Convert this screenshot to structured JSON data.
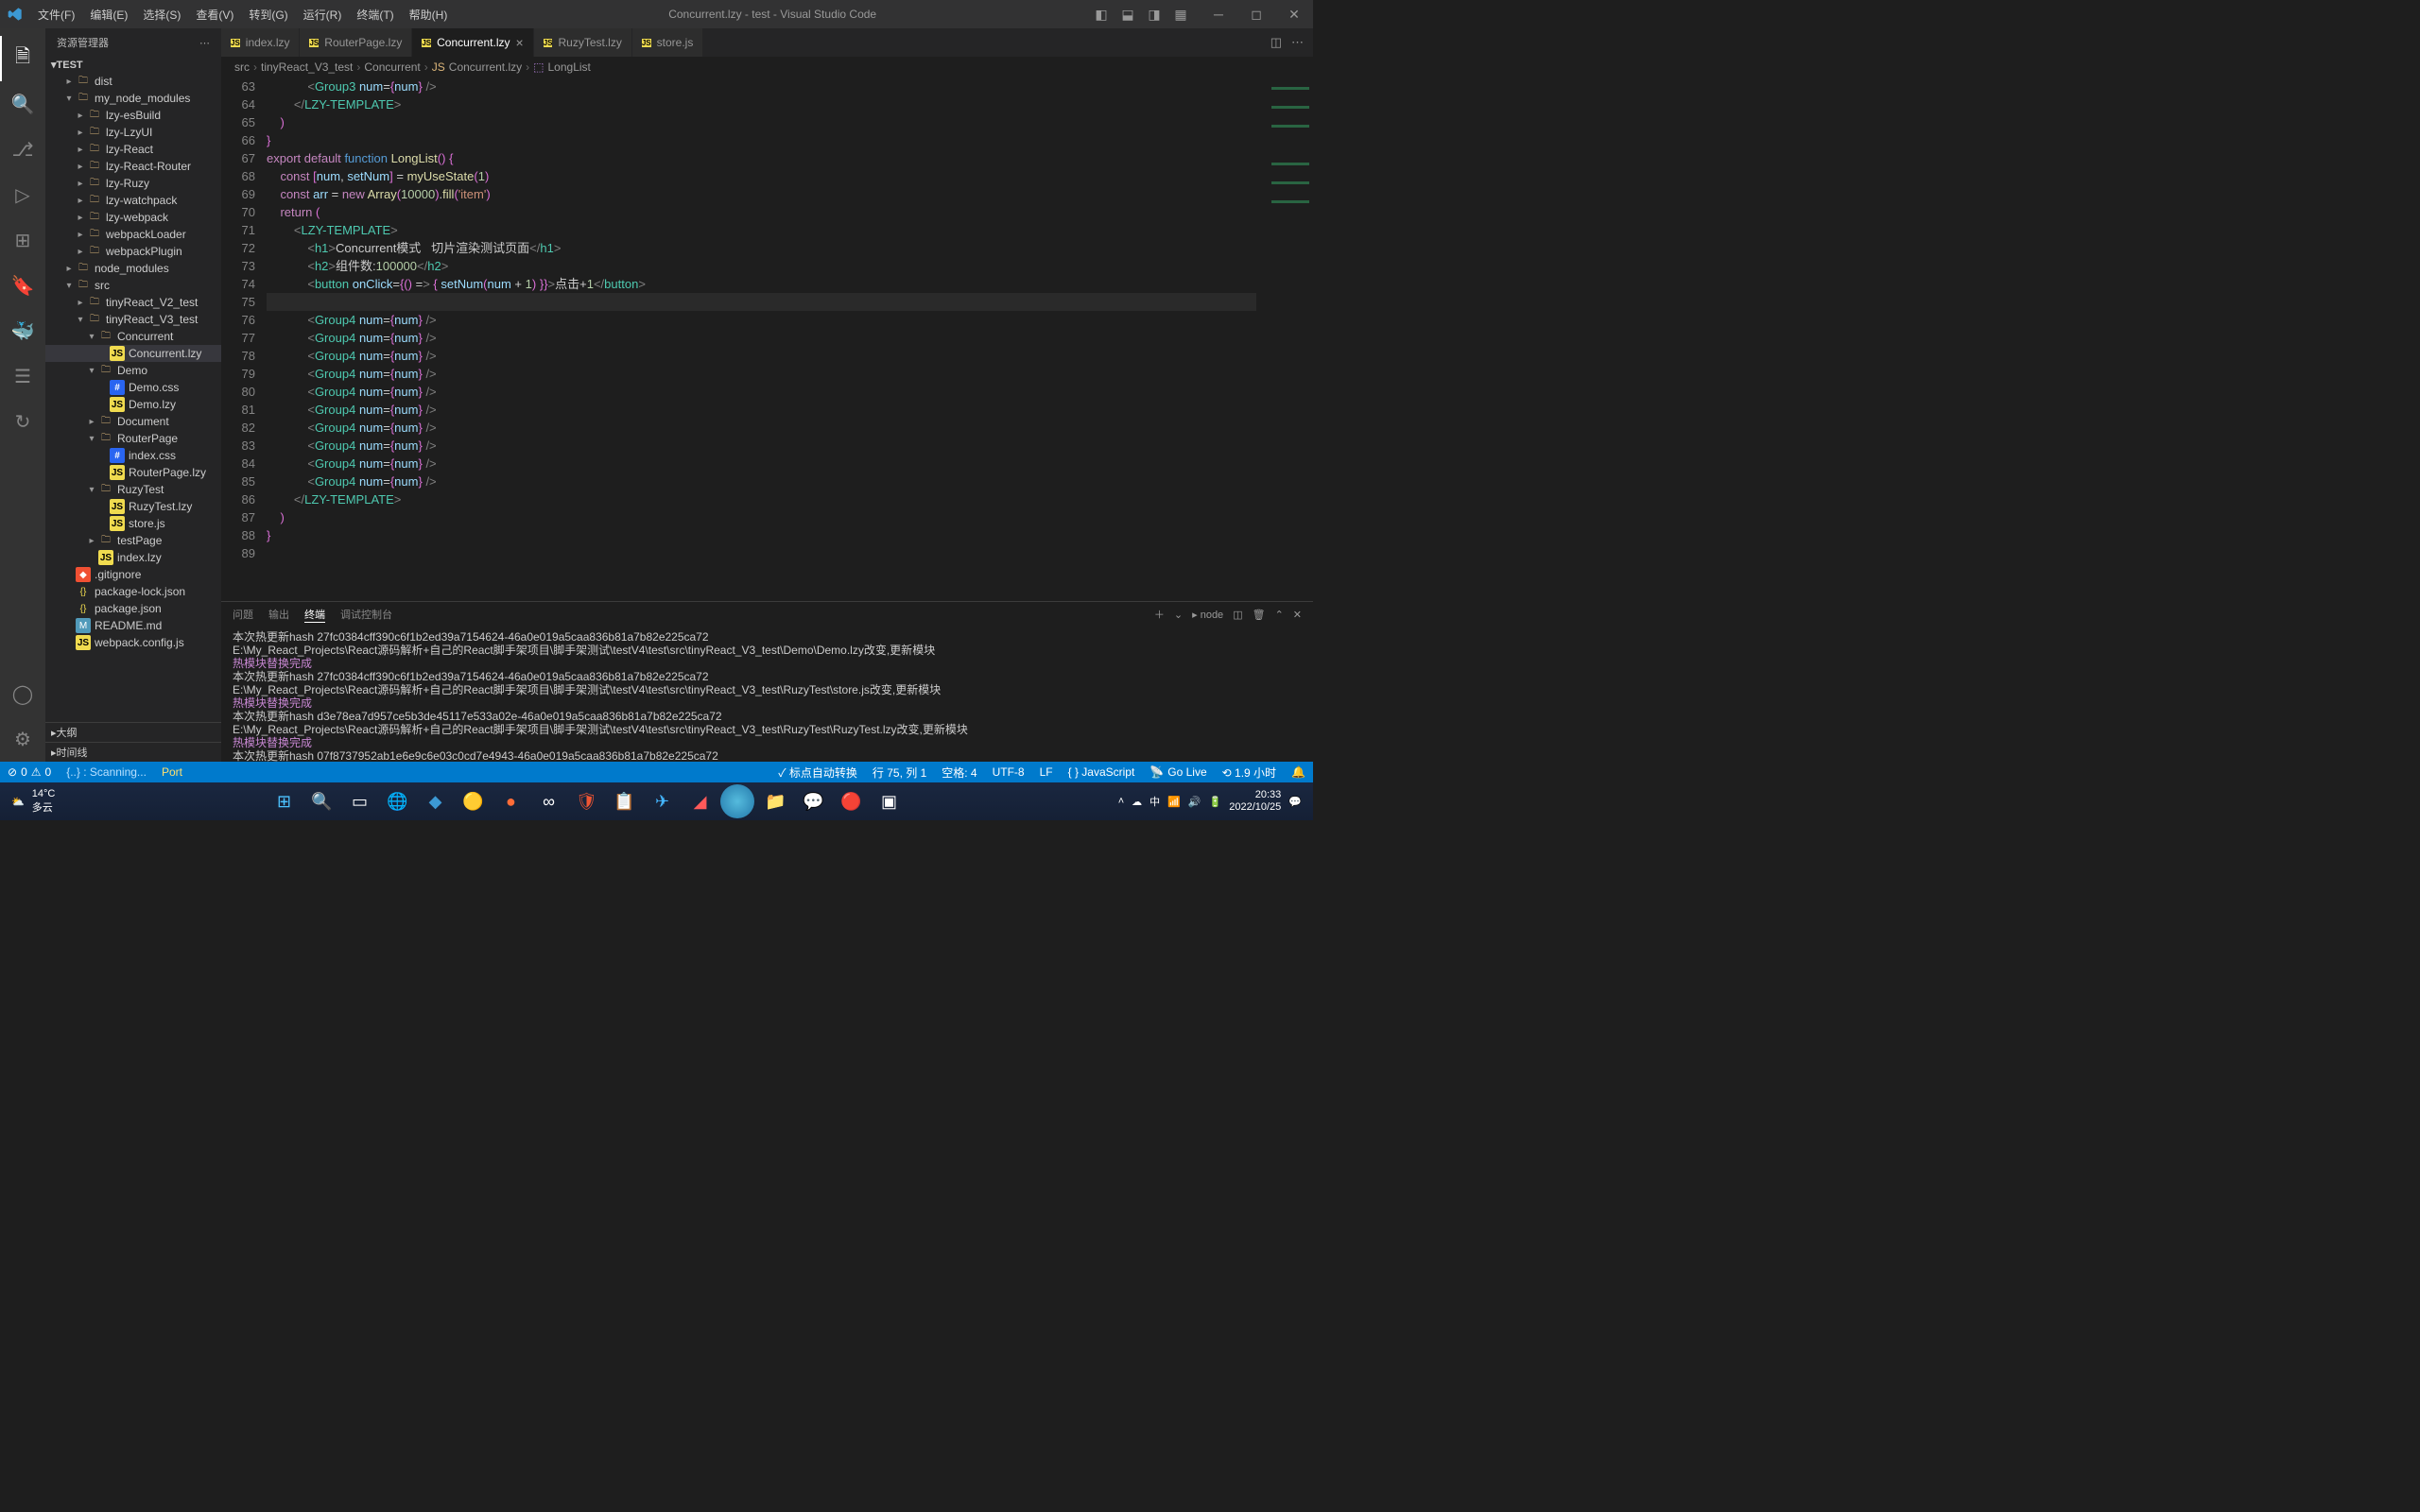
{
  "titlebar": {
    "menu": [
      "文件(F)",
      "编辑(E)",
      "选择(S)",
      "查看(V)",
      "转到(G)",
      "运行(R)",
      "终端(T)",
      "帮助(H)"
    ],
    "title": "Concurrent.lzy - test - Visual Studio Code"
  },
  "sidebar": {
    "header": "资源管理器",
    "root": "TEST",
    "outline": "大纲",
    "timeline": "时间线"
  },
  "tree": [
    {
      "d": 1,
      "chev": "▸",
      "icon": "folder",
      "label": "dist"
    },
    {
      "d": 1,
      "chev": "▾",
      "icon": "folder",
      "label": "my_node_modules"
    },
    {
      "d": 2,
      "chev": "▸",
      "icon": "folder",
      "label": "lzy-esBuild"
    },
    {
      "d": 2,
      "chev": "▸",
      "icon": "folder",
      "label": "lzy-LzyUI"
    },
    {
      "d": 2,
      "chev": "▸",
      "icon": "folder",
      "label": "lzy-React"
    },
    {
      "d": 2,
      "chev": "▸",
      "icon": "folder",
      "label": "lzy-React-Router"
    },
    {
      "d": 2,
      "chev": "▸",
      "icon": "folder",
      "label": "lzy-Ruzy"
    },
    {
      "d": 2,
      "chev": "▸",
      "icon": "folder",
      "label": "lzy-watchpack"
    },
    {
      "d": 2,
      "chev": "▸",
      "icon": "folder",
      "label": "lzy-webpack"
    },
    {
      "d": 2,
      "chev": "▸",
      "icon": "folder",
      "label": "webpackLoader"
    },
    {
      "d": 2,
      "chev": "▸",
      "icon": "folder",
      "label": "webpackPlugin"
    },
    {
      "d": 1,
      "chev": "▸",
      "icon": "folder",
      "label": "node_modules"
    },
    {
      "d": 1,
      "chev": "▾",
      "icon": "folder",
      "label": "src"
    },
    {
      "d": 2,
      "chev": "▸",
      "icon": "folder",
      "label": "tinyReact_V2_test"
    },
    {
      "d": 2,
      "chev": "▾",
      "icon": "folder",
      "label": "tinyReact_V3_test"
    },
    {
      "d": 3,
      "chev": "▾",
      "icon": "folder",
      "label": "Concurrent"
    },
    {
      "d": 4,
      "chev": "",
      "icon": "js",
      "label": "Concurrent.lzy",
      "selected": true
    },
    {
      "d": 3,
      "chev": "▾",
      "icon": "folder",
      "label": "Demo"
    },
    {
      "d": 4,
      "chev": "",
      "icon": "css",
      "label": "Demo.css"
    },
    {
      "d": 4,
      "chev": "",
      "icon": "js",
      "label": "Demo.lzy"
    },
    {
      "d": 3,
      "chev": "▸",
      "icon": "folder",
      "label": "Document"
    },
    {
      "d": 3,
      "chev": "▾",
      "icon": "folder",
      "label": "RouterPage"
    },
    {
      "d": 4,
      "chev": "",
      "icon": "css",
      "label": "index.css"
    },
    {
      "d": 4,
      "chev": "",
      "icon": "js",
      "label": "RouterPage.lzy"
    },
    {
      "d": 3,
      "chev": "▾",
      "icon": "folder",
      "label": "RuzyTest"
    },
    {
      "d": 4,
      "chev": "",
      "icon": "js",
      "label": "RuzyTest.lzy"
    },
    {
      "d": 4,
      "chev": "",
      "icon": "js",
      "label": "store.js"
    },
    {
      "d": 3,
      "chev": "▸",
      "icon": "folder",
      "label": "testPage"
    },
    {
      "d": 3,
      "chev": "",
      "icon": "js",
      "label": "index.lzy"
    },
    {
      "d": 1,
      "chev": "",
      "icon": "git",
      "label": ".gitignore"
    },
    {
      "d": 1,
      "chev": "",
      "icon": "json",
      "label": "package-lock.json"
    },
    {
      "d": 1,
      "chev": "",
      "icon": "json",
      "label": "package.json"
    },
    {
      "d": 1,
      "chev": "",
      "icon": "md",
      "label": "README.md"
    },
    {
      "d": 1,
      "chev": "",
      "icon": "js",
      "label": "webpack.config.js"
    }
  ],
  "tabs": [
    {
      "icon": "js",
      "label": "index.lzy"
    },
    {
      "icon": "js",
      "label": "RouterPage.lzy"
    },
    {
      "icon": "js",
      "label": "Concurrent.lzy",
      "active": true,
      "close": true
    },
    {
      "icon": "js",
      "label": "RuzyTest.lzy"
    },
    {
      "icon": "js",
      "label": "store.js"
    }
  ],
  "breadcrumb": [
    "src",
    "tinyReact_V3_test",
    "Concurrent",
    "Concurrent.lzy",
    "LongList"
  ],
  "code": {
    "start": 63,
    "current": 75,
    "lines": [
      "            <Group3 num={num} />",
      "        </LZY-TEMPLATE>",
      "    )",
      "}",
      "export default function LongList() {",
      "    const [num, setNum] = myUseState(1)",
      "    const arr = new Array(10000).fill('item')",
      "    return (",
      "        <LZY-TEMPLATE>",
      "            <h1>Concurrent模式   切片渲染测试页面</h1>",
      "            <h2>组件数:100000</h2>",
      "            <button onClick={() => { setNum(num + 1) }}>点击+1</button>",
      "",
      "            <Group4 num={num} />",
      "            <Group4 num={num} />",
      "            <Group4 num={num} />",
      "            <Group4 num={num} />",
      "            <Group4 num={num} />",
      "            <Group4 num={num} />",
      "            <Group4 num={num} />",
      "            <Group4 num={num} />",
      "            <Group4 num={num} />",
      "            <Group4 num={num} />",
      "        </LZY-TEMPLATE>",
      "    )",
      "}",
      ""
    ]
  },
  "panel": {
    "tabs": [
      "问题",
      "输出",
      "终端",
      "调试控制台"
    ],
    "active": 2,
    "right_label": "node",
    "lines": [
      {
        "t": "本次热更新hash 27fc0384cff390c6f1b2ed39a7154624-46a0e019a5caa836b81a7b82e225ca72"
      },
      {
        "t": "E:\\My_React_Projects\\React源码解析+自己的React脚手架项目\\脚手架测试\\testV4\\test\\src\\tinyReact_V3_test\\Demo\\Demo.lzy改变,更新模块"
      },
      {
        "t": "热模块替换完成",
        "hot": true
      },
      {
        "t": "本次热更新hash 27fc0384cff390c6f1b2ed39a7154624-46a0e019a5caa836b81a7b82e225ca72"
      },
      {
        "t": "E:\\My_React_Projects\\React源码解析+自己的React脚手架项目\\脚手架测试\\testV4\\test\\src\\tinyReact_V3_test\\RuzyTest\\store.js改变,更新模块"
      },
      {
        "t": "热模块替换完成",
        "hot": true
      },
      {
        "t": "本次热更新hash d3e78ea7d957ce5b3de45117e533a02e-46a0e019a5caa836b81a7b82e225ca72"
      },
      {
        "t": "E:\\My_React_Projects\\React源码解析+自己的React脚手架项目\\脚手架测试\\testV4\\test\\src\\tinyReact_V3_test\\RuzyTest\\RuzyTest.lzy改变,更新模块"
      },
      {
        "t": "热模块替换完成",
        "hot": true
      },
      {
        "t": "本次热更新hash 07f8737952ab1e6e9c6e03c0cd7e4943-46a0e019a5caa836b81a7b82e225ca72"
      },
      {
        "t": "▯"
      }
    ]
  },
  "statusbar": {
    "errors": "0",
    "warnings": "0",
    "scanning": "{..} : Scanning...",
    "port": "Port",
    "autosave": "✓ 标点自动转换",
    "lncol": "行 75,  列 1",
    "spaces": "空格: 4",
    "encoding": "UTF-8",
    "eol": "LF",
    "lang": "{ } JavaScript",
    "golive": "Go Live",
    "time": "⟲ 1.9 小时"
  },
  "taskbar": {
    "temp": "14°C",
    "weather": "多云",
    "time": "20:33",
    "date": "2022/10/25"
  }
}
